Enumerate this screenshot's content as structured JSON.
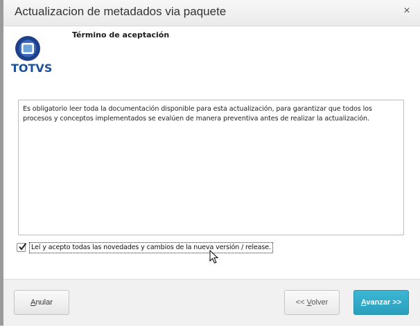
{
  "window": {
    "title": "Actualizacion de metadados via paquete",
    "close_glyph": "×"
  },
  "logo": {
    "text": "TOTVS",
    "colors": {
      "ring": "#1e3f8a",
      "center": "#6fa3d9",
      "text": "#1c4f9c"
    }
  },
  "section": {
    "heading": "Término de aceptación"
  },
  "terms": {
    "text": "Es obligatorio leer toda la documentación disponible para esta actualización, para garantizar que todos los procesos y conceptos implementados se evalúen de manera preventiva antes de realizar la actualización."
  },
  "acceptance": {
    "checked": true,
    "label": "Leí y acepto todas las novedades y cambios de la nueva versión / release."
  },
  "buttons": {
    "cancel": {
      "mnemonic": "A",
      "rest": "nular"
    },
    "back": {
      "prefix": "<< ",
      "mnemonic": "V",
      "rest": "olver"
    },
    "next": {
      "mnemonic": "A",
      "rest": "vanzar >>"
    }
  },
  "colors": {
    "accent": "#2fa8c6"
  }
}
